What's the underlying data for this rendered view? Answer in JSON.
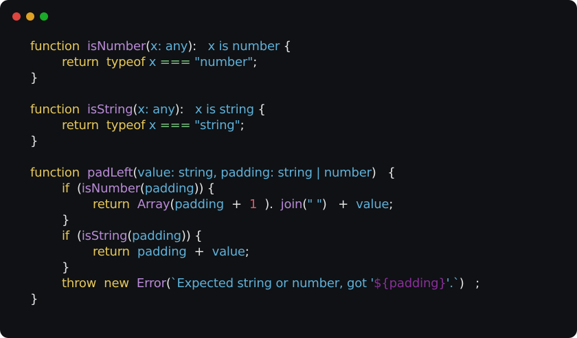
{
  "window": {
    "controls": {
      "close_color": "#e0443e",
      "minimize_color": "#dea123",
      "maximize_color": "#1aab29"
    }
  },
  "code": {
    "language": "typescript",
    "lines": [
      {
        "indent": 0,
        "tokens": [
          {
            "t": "function",
            "k": "kw"
          },
          {
            "t": "  ",
            "k": "pu"
          },
          {
            "t": "isNumber",
            "k": "fn"
          },
          {
            "t": "(",
            "k": "pu"
          },
          {
            "t": "x: any",
            "k": "ty"
          },
          {
            "t": "):",
            "k": "pu"
          },
          {
            "t": "   ",
            "k": "pu"
          },
          {
            "t": "x is number",
            "k": "ty"
          },
          {
            "t": " {",
            "k": "pu"
          }
        ]
      },
      {
        "indent": 1,
        "tokens": [
          {
            "t": "return",
            "k": "kw"
          },
          {
            "t": "  ",
            "k": "pu"
          },
          {
            "t": "typeof",
            "k": "kw"
          },
          {
            "t": " ",
            "k": "pu"
          },
          {
            "t": "x",
            "k": "ty"
          },
          {
            "t": " ",
            "k": "pu"
          },
          {
            "t": "===",
            "k": "op"
          },
          {
            "t": " ",
            "k": "pu"
          },
          {
            "t": "\"number\"",
            "k": "st"
          },
          {
            "t": ";",
            "k": "pu"
          }
        ]
      },
      {
        "indent": 0,
        "tokens": [
          {
            "t": "}",
            "k": "pu"
          }
        ]
      },
      {
        "indent": 0,
        "tokens": []
      },
      {
        "indent": 0,
        "tokens": [
          {
            "t": "function",
            "k": "kw"
          },
          {
            "t": "  ",
            "k": "pu"
          },
          {
            "t": "isString",
            "k": "fn"
          },
          {
            "t": "(",
            "k": "pu"
          },
          {
            "t": "x: any",
            "k": "ty"
          },
          {
            "t": "):",
            "k": "pu"
          },
          {
            "t": "   ",
            "k": "pu"
          },
          {
            "t": "x is string",
            "k": "ty"
          },
          {
            "t": " {",
            "k": "pu"
          }
        ]
      },
      {
        "indent": 1,
        "tokens": [
          {
            "t": "return",
            "k": "kw"
          },
          {
            "t": "  ",
            "k": "pu"
          },
          {
            "t": "typeof",
            "k": "kw"
          },
          {
            "t": " ",
            "k": "pu"
          },
          {
            "t": "x",
            "k": "ty"
          },
          {
            "t": " ",
            "k": "pu"
          },
          {
            "t": "===",
            "k": "op"
          },
          {
            "t": " ",
            "k": "pu"
          },
          {
            "t": "\"string\"",
            "k": "st"
          },
          {
            "t": ";",
            "k": "pu"
          }
        ]
      },
      {
        "indent": 0,
        "tokens": [
          {
            "t": "}",
            "k": "pu"
          }
        ]
      },
      {
        "indent": 0,
        "tokens": []
      },
      {
        "indent": 0,
        "tokens": [
          {
            "t": "function",
            "k": "kw"
          },
          {
            "t": "  ",
            "k": "pu"
          },
          {
            "t": "padLeft",
            "k": "fn"
          },
          {
            "t": "(",
            "k": "pu"
          },
          {
            "t": "value: string, padding: string | number",
            "k": "ty"
          },
          {
            "t": ")",
            "k": "pu"
          },
          {
            "t": "   {",
            "k": "pu"
          }
        ]
      },
      {
        "indent": 1,
        "tokens": [
          {
            "t": "if",
            "k": "kw"
          },
          {
            "t": "  (",
            "k": "pu"
          },
          {
            "t": "isNumber",
            "k": "fn"
          },
          {
            "t": "(",
            "k": "pu"
          },
          {
            "t": "padding",
            "k": "ty"
          },
          {
            "t": ")) {",
            "k": "pu"
          }
        ]
      },
      {
        "indent": 2,
        "tokens": [
          {
            "t": "return",
            "k": "kw"
          },
          {
            "t": "  ",
            "k": "pu"
          },
          {
            "t": "Array",
            "k": "fn"
          },
          {
            "t": "(",
            "k": "pu"
          },
          {
            "t": "padding",
            "k": "ty"
          },
          {
            "t": "  +  ",
            "k": "pu"
          },
          {
            "t": "1",
            "k": "num"
          },
          {
            "t": "  ).  ",
            "k": "pu"
          },
          {
            "t": "join",
            "k": "fn"
          },
          {
            "t": "(",
            "k": "pu"
          },
          {
            "t": "\" \"",
            "k": "st"
          },
          {
            "t": ")   +  ",
            "k": "pu"
          },
          {
            "t": "value",
            "k": "ty"
          },
          {
            "t": ";",
            "k": "pu"
          }
        ]
      },
      {
        "indent": 1,
        "tokens": [
          {
            "t": "}",
            "k": "pu"
          }
        ]
      },
      {
        "indent": 1,
        "tokens": [
          {
            "t": "if",
            "k": "kw"
          },
          {
            "t": "  (",
            "k": "pu"
          },
          {
            "t": "isString",
            "k": "fn"
          },
          {
            "t": "(",
            "k": "pu"
          },
          {
            "t": "padding",
            "k": "ty"
          },
          {
            "t": ")) {",
            "k": "pu"
          }
        ]
      },
      {
        "indent": 2,
        "tokens": [
          {
            "t": "return",
            "k": "kw"
          },
          {
            "t": "  ",
            "k": "pu"
          },
          {
            "t": "padding",
            "k": "ty"
          },
          {
            "t": "  +  ",
            "k": "pu"
          },
          {
            "t": "value",
            "k": "ty"
          },
          {
            "t": ";",
            "k": "pu"
          }
        ]
      },
      {
        "indent": 1,
        "tokens": [
          {
            "t": "}",
            "k": "pu"
          }
        ]
      },
      {
        "indent": 1,
        "tokens": [
          {
            "t": "throw",
            "k": "kw"
          },
          {
            "t": "  ",
            "k": "pu"
          },
          {
            "t": "new",
            "k": "kw"
          },
          {
            "t": "  ",
            "k": "pu"
          },
          {
            "t": "Error",
            "k": "fn"
          },
          {
            "t": "(",
            "k": "pu"
          },
          {
            "t": "`Expected string or number, got '",
            "k": "st"
          },
          {
            "t": "${padding}",
            "k": "tpl"
          },
          {
            "t": "'.`",
            "k": "st"
          },
          {
            "t": ")   ;",
            "k": "pu"
          }
        ]
      },
      {
        "indent": 0,
        "tokens": [
          {
            "t": "}",
            "k": "pu"
          }
        ]
      }
    ]
  }
}
